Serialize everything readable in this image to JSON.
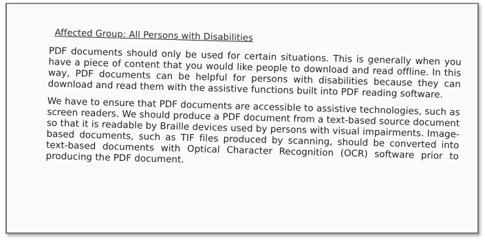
{
  "document": {
    "heading": "Affected Group: All Persons with Disabilities",
    "paragraphs": [
      "PDF documents should only be used for certain situations. This is generally when you have a piece of content that you would like people to download and read offline. In this way, PDF documents can be helpful for persons with disabilities because they can download and read them with the assistive functions built into PDF reading software.",
      "We have to ensure that PDF documents are accessible to assistive technologies, such as screen readers. We should produce a PDF document from a text-based source document so that it is readable by Braille devices used by persons with visual impairments. Image-based documents, such as TIF files produced by scanning, should be converted into text-based documents with Optical Character Recognition (OCR) software prior to producing the PDF document."
    ]
  }
}
